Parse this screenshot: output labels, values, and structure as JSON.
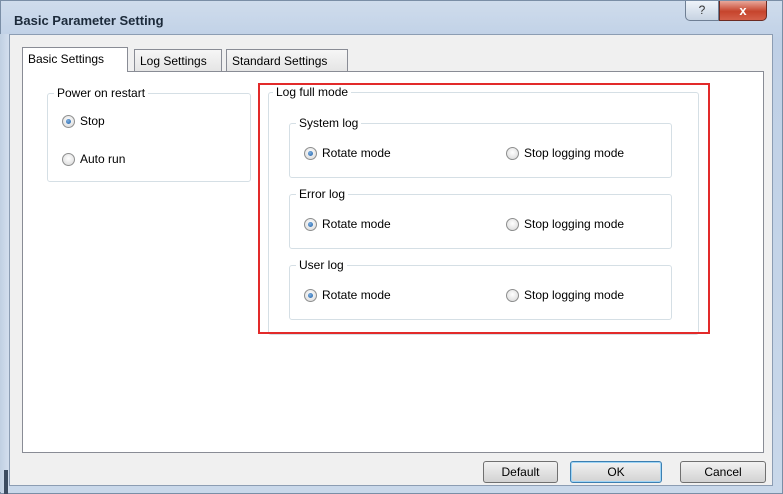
{
  "window": {
    "title": "Basic Parameter Setting",
    "help_label": "?",
    "close_label": "x"
  },
  "tabs": [
    {
      "label": "Basic Settings",
      "active": true
    },
    {
      "label": "Log Settings",
      "active": false
    },
    {
      "label": "Standard Settings",
      "active": false
    }
  ],
  "power_on_restart": {
    "legend": "Power on restart",
    "options": [
      {
        "label": "Stop",
        "checked": true
      },
      {
        "label": "Auto run",
        "checked": false
      }
    ]
  },
  "log_full_mode": {
    "legend": "Log full mode",
    "groups": [
      {
        "legend": "System log",
        "options": [
          {
            "label": "Rotate mode",
            "checked": true
          },
          {
            "label": "Stop logging mode",
            "checked": false
          }
        ]
      },
      {
        "legend": "Error log",
        "options": [
          {
            "label": "Rotate mode",
            "checked": true
          },
          {
            "label": "Stop logging mode",
            "checked": false
          }
        ]
      },
      {
        "legend": "User log",
        "options": [
          {
            "label": "Rotate mode",
            "checked": true
          },
          {
            "label": "Stop logging mode",
            "checked": false
          }
        ]
      }
    ]
  },
  "buttons": {
    "default_label": "Default",
    "ok_label": "OK",
    "cancel_label": "Cancel"
  },
  "colors": {
    "highlight": "#e22a2a",
    "radio_selected": "#1b5ea8"
  }
}
